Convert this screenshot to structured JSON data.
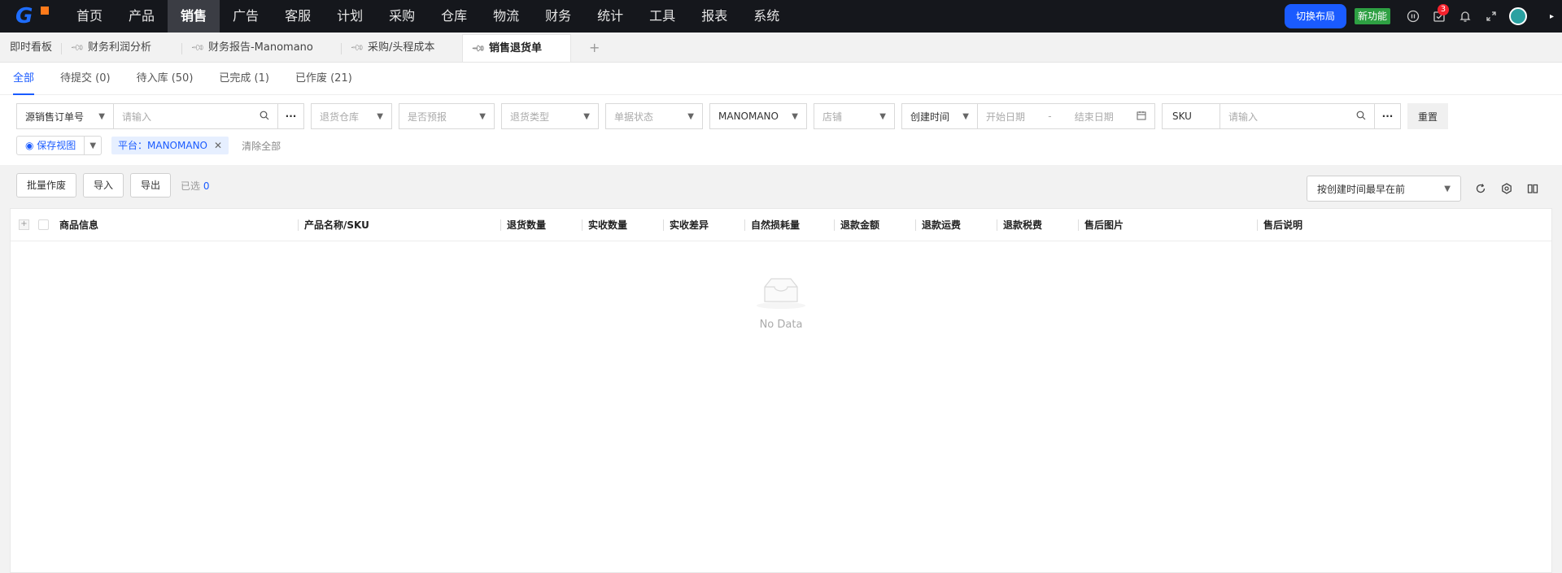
{
  "nav": {
    "items": [
      "首页",
      "产品",
      "销售",
      "广告",
      "客服",
      "计划",
      "采购",
      "仓库",
      "物流",
      "财务",
      "统计",
      "工具",
      "报表",
      "系统"
    ],
    "active_index": 2,
    "switch_layout": "切换布局",
    "new_feature": "新功能",
    "notification_count": "3"
  },
  "page_tabs": [
    {
      "label": "即时看板",
      "pinned": false
    },
    {
      "label": "财务利润分析",
      "pinned": true
    },
    {
      "label": "财务报告-Manomano",
      "pinned": true
    },
    {
      "label": "采购/头程成本",
      "pinned": true
    },
    {
      "label": "销售退货单",
      "pinned": true,
      "active": true
    }
  ],
  "status_tabs": [
    "全部",
    "待提交 (0)",
    "待入库 (50)",
    "已完成 (1)",
    "已作废 (21)"
  ],
  "filters": {
    "order_type": "源销售订单号",
    "order_placeholder": "请输入",
    "warehouse": "退货仓库",
    "forecast": "是否预报",
    "return_type": "退货类型",
    "doc_status": "单据状态",
    "platform": "MANOMANO",
    "shop": "店铺",
    "time_type": "创建时间",
    "start_date": "开始日期",
    "date_sep": "-",
    "end_date": "结束日期",
    "sku_label": "SKU",
    "sku_placeholder": "请输入",
    "reset": "重置",
    "save_view": "保存视图",
    "chip": "平台：MANOMANO",
    "clear_all": "清除全部"
  },
  "toolbar": {
    "batch_void": "批量作废",
    "import": "导入",
    "export": "导出",
    "selected_label": "已选",
    "selected_count": "0",
    "sort": "按创建时间最早在前"
  },
  "table": {
    "columns": [
      "商品信息",
      "产品名称/SKU",
      "退货数量",
      "实收数量",
      "实收差异",
      "自然损耗量",
      "退款金额",
      "退款运费",
      "退款税费",
      "售后图片",
      "售后说明"
    ],
    "empty_text": "No Data"
  },
  "colors": {
    "accent": "#1a5bff",
    "nav_bg": "#15171c",
    "new_badge": "#2ea043"
  }
}
